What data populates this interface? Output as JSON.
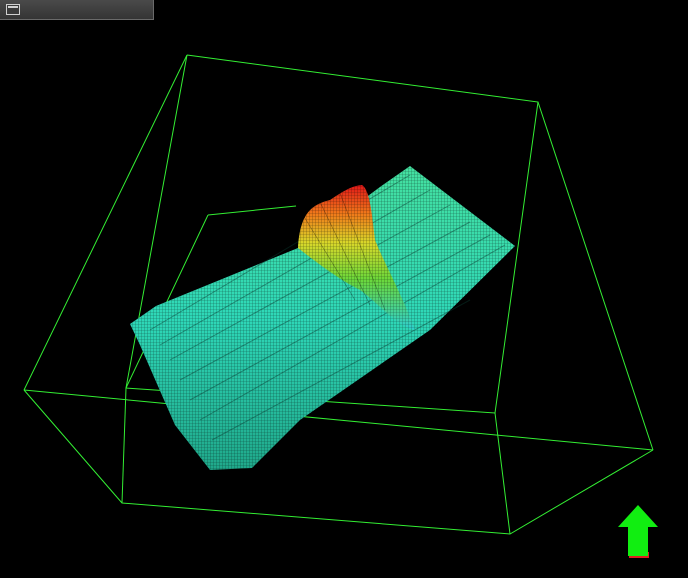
{
  "window": {
    "title": "",
    "button_icon": "window-restore-icon"
  },
  "scene": {
    "type": "3d-surface-wireframe",
    "background": "#000000",
    "box_color": "#33ee33",
    "colormap": [
      "#1fbf9f",
      "#22d6a8",
      "#2ed4c8",
      "#7cd63a",
      "#d6d62a",
      "#f07a1a",
      "#e01818"
    ],
    "surface_mesh": "#000000",
    "peak_position": "center-back",
    "orientation_arrow": {
      "icon": "arrow-up-icon",
      "color": "#11ee11",
      "base_color": "#e02020"
    }
  }
}
